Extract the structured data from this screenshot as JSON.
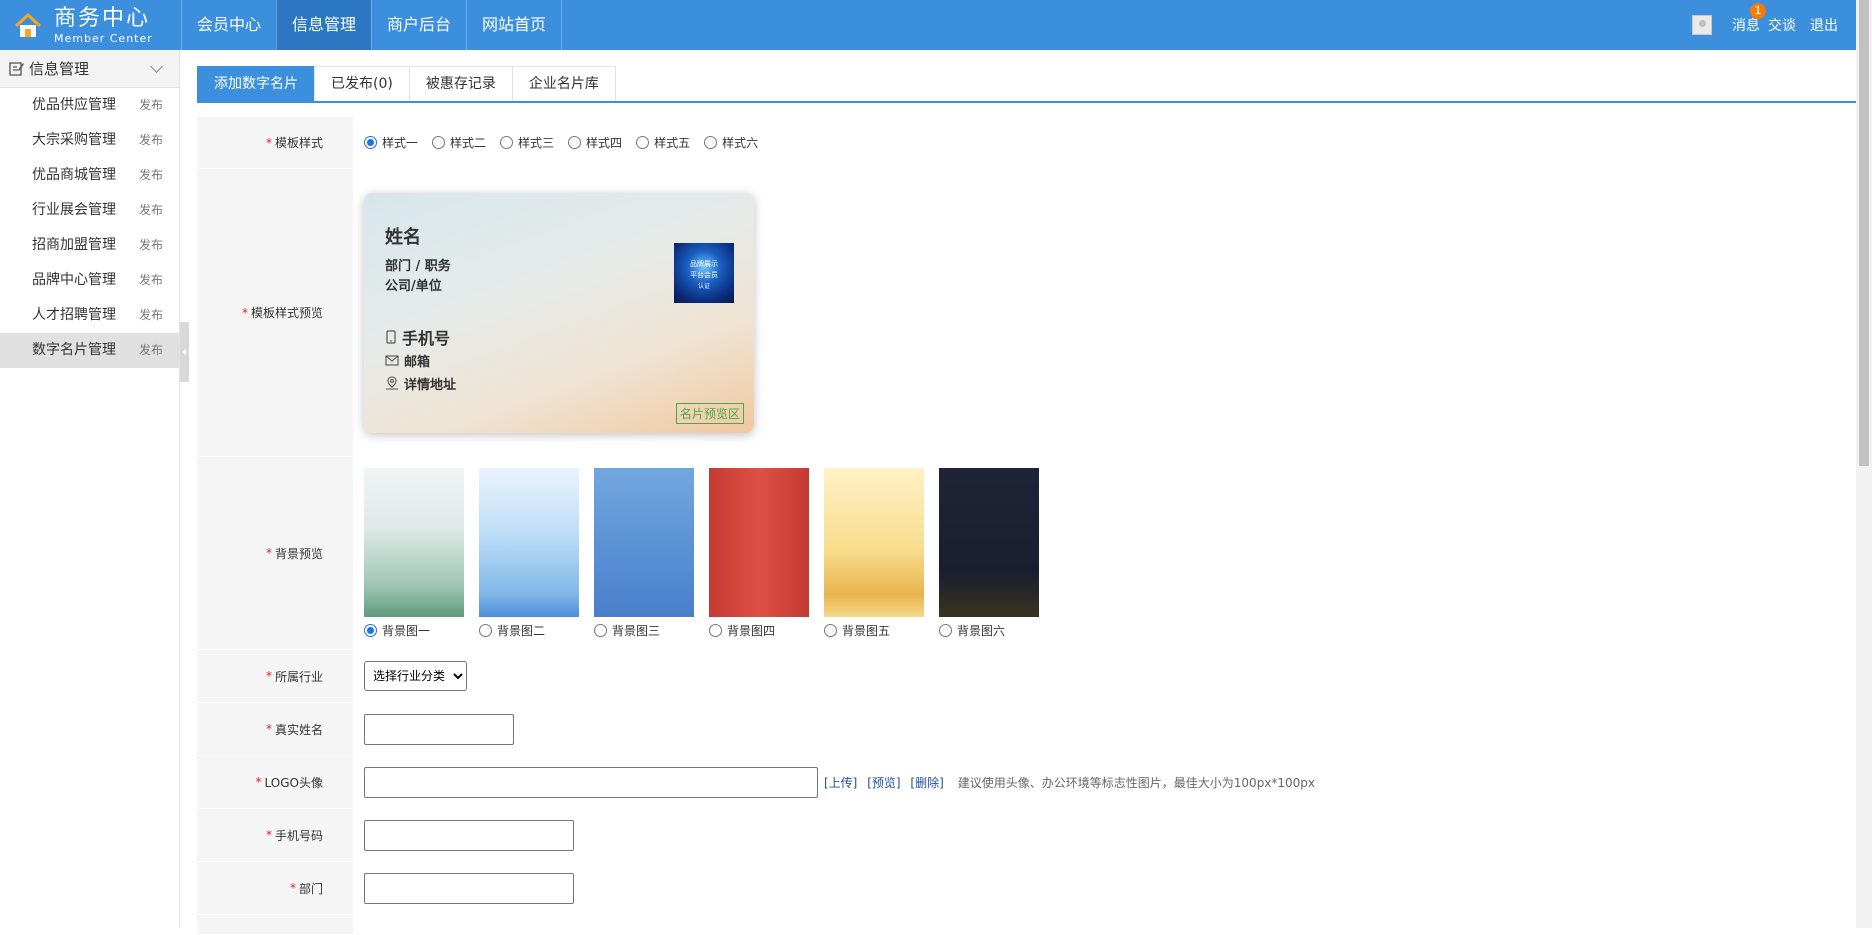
{
  "header": {
    "title": "商务中心",
    "subtitle": "Member Center",
    "nav": [
      "会员中心",
      "信息管理",
      "商户后台",
      "网站首页"
    ],
    "active_nav": 1,
    "links": {
      "message": "消息",
      "message_badge": "1",
      "chat": "交谈",
      "logout": "退出"
    },
    "accent": "#3b8fdc"
  },
  "sidebar": {
    "title": "信息管理",
    "items": [
      {
        "label": "优品供应管理",
        "action": "发布"
      },
      {
        "label": "大宗采购管理",
        "action": "发布"
      },
      {
        "label": "优品商城管理",
        "action": "发布"
      },
      {
        "label": "行业展会管理",
        "action": "发布"
      },
      {
        "label": "招商加盟管理",
        "action": "发布"
      },
      {
        "label": "品牌中心管理",
        "action": "发布"
      },
      {
        "label": "人才招聘管理",
        "action": "发布"
      },
      {
        "label": "数字名片管理",
        "action": "发布"
      }
    ],
    "active_index": 7
  },
  "tabs": [
    "添加数字名片",
    "已发布(0)",
    "被惠存记录",
    "企业名片库"
  ],
  "form": {
    "template_style": {
      "label": "模板样式",
      "options": [
        "样式一",
        "样式二",
        "样式三",
        "样式四",
        "样式五",
        "样式六"
      ],
      "selected": 0
    },
    "template_preview": {
      "label": "模板样式预览",
      "card": {
        "name": "姓名",
        "dept": "部门 / 职务",
        "company": "公司/单位",
        "phone": "手机号",
        "email": "邮箱",
        "address": "详情地址",
        "tag": "名片预览区",
        "qr_text": [
          "品牌展示",
          "平台会员",
          "认证"
        ]
      }
    },
    "bg_preview": {
      "label": "背景预览",
      "options": [
        "背景图一",
        "背景图二",
        "背景图三",
        "背景图四",
        "背景图五",
        "背景图六"
      ],
      "selected": 0
    },
    "industry": {
      "label": "所属行业",
      "value": "选择行业分类"
    },
    "real_name": {
      "label": "真实姓名",
      "value": ""
    },
    "logo": {
      "label": "LOGO头像",
      "value": "",
      "upload": "[上传]",
      "preview": "[预览]",
      "delete": "[删除]",
      "hint": "建议使用头像、办公环境等标志性图片，最佳大小为100px*100px"
    },
    "phone": {
      "label": "手机号码",
      "value": ""
    },
    "dept": {
      "label": "部门",
      "value": ""
    }
  }
}
